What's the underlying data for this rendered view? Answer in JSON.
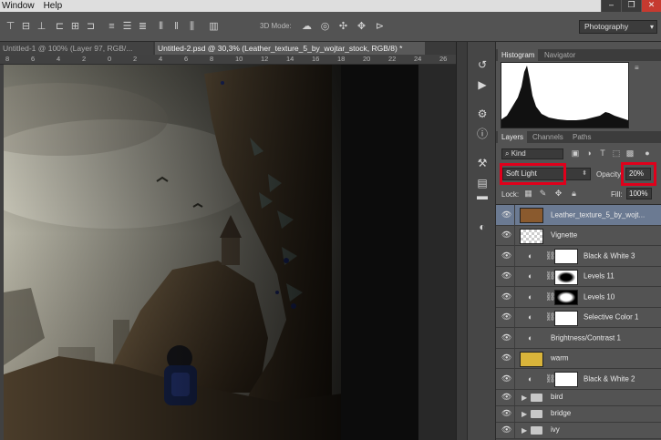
{
  "menu": {
    "items": [
      "Window",
      "Help"
    ]
  },
  "options_bar": {
    "mode_label": "3D Mode:",
    "workspace": "Photography"
  },
  "tabs": [
    {
      "title": "Untitled-1 @ 100% (Layer 97, RGB/..."
    },
    {
      "title": "Untitled-2.psd @ 30,3% (Leather_texture_5_by_wojtar_stock, RGB/8) *"
    }
  ],
  "ruler": [
    "8",
    "6",
    "4",
    "2",
    "0",
    "2",
    "4",
    "6",
    "8",
    "10",
    "12",
    "14",
    "16",
    "18",
    "20",
    "22",
    "24",
    "26"
  ],
  "panels": {
    "top_tabs": [
      "Histogram",
      "Navigator"
    ],
    "layer_tabs": [
      "Layers",
      "Channels",
      "Paths"
    ],
    "kind_label": "Kind",
    "blend_mode": "Soft Light",
    "opacity_label": "Opacity:",
    "opacity_value": "20%",
    "lock_label": "Lock:",
    "fill_label": "Fill:",
    "fill_value": "100%"
  },
  "layers": [
    {
      "name": "Leather_texture_5_by_wojt...",
      "selected": true
    },
    {
      "name": "Vignette"
    },
    {
      "name": "Black & White 3"
    },
    {
      "name": "Levels 11"
    },
    {
      "name": "Levels 10"
    },
    {
      "name": "Selective Color 1"
    },
    {
      "name": "Brightness/Contrast 1"
    },
    {
      "name": "warm"
    },
    {
      "name": "Black & White 2"
    }
  ],
  "groups": [
    {
      "name": "bird"
    },
    {
      "name": "bridge"
    },
    {
      "name": "ivy"
    }
  ],
  "colors": {
    "highlight": "#e0001b",
    "selected_layer": "#6b7a92",
    "warm_fill": "#d9b43a"
  }
}
